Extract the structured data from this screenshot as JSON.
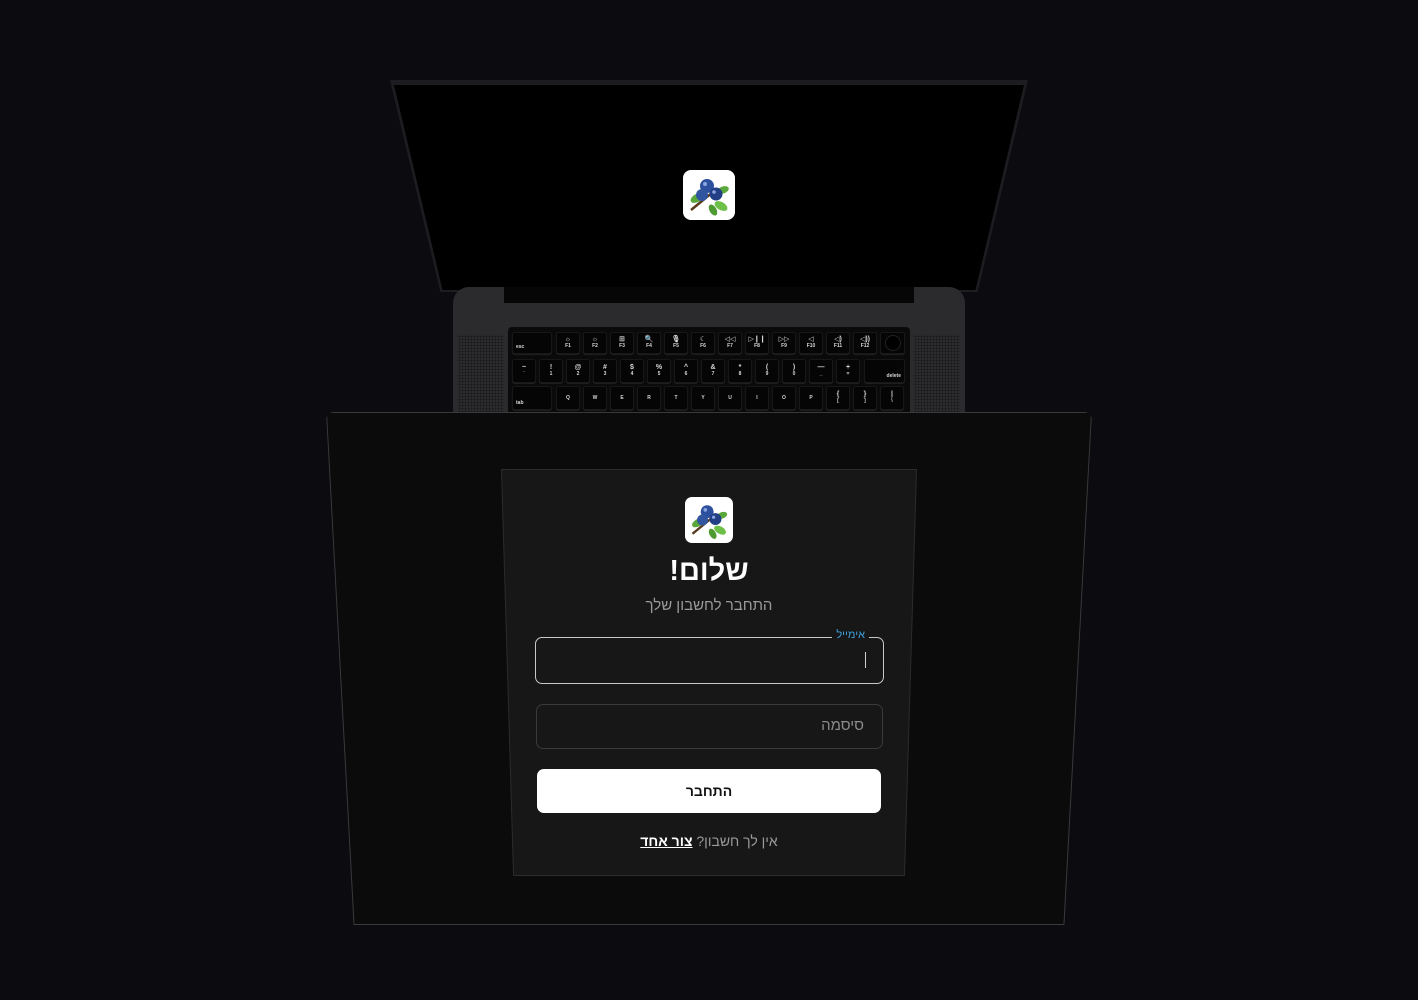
{
  "screen": {
    "logo_icon": "blueberry-logo-icon"
  },
  "keyboard": {
    "row_fn": [
      "esc",
      "F1",
      "F2",
      "F3",
      "F4",
      "F5",
      "F6",
      "F7",
      "F8",
      "F9",
      "F10",
      "F11",
      "F12"
    ],
    "row_fn_symbols": [
      "",
      "☼",
      "☼",
      "⊞",
      "🔍",
      "🎙",
      "☾",
      "◁◁",
      "▷❙❙",
      "▷▷",
      "◁",
      "◁)",
      "◁))"
    ],
    "row_num_top": [
      "~",
      "!",
      "@",
      "#",
      "$",
      "%",
      "^",
      "&",
      "*",
      "(",
      ")",
      "—",
      "+"
    ],
    "row_num_bottom": [
      "`",
      "1",
      "2",
      "3",
      "4",
      "5",
      "6",
      "7",
      "8",
      "9",
      "0",
      "_",
      "="
    ],
    "delete_label": "delete",
    "tab_label": "tab",
    "row_q": [
      "Q",
      "W",
      "E",
      "R",
      "T",
      "Y",
      "U",
      "I",
      "O",
      "P"
    ],
    "row_q_extra_top": [
      "{",
      "}",
      "|"
    ],
    "row_q_extra_bottom": [
      "[",
      "]",
      "\\"
    ]
  },
  "login": {
    "logo_icon": "blueberry-logo-icon",
    "title": "שלום!",
    "subtitle": "התחבר לחשבון שלך",
    "email_label": "אימייל",
    "email_value": "",
    "password_placeholder": "סיסמה",
    "submit_label": "התחבר",
    "signup_prompt": "אין לך חשבון?",
    "signup_link": "צור אחד"
  },
  "colors": {
    "background": "#0c0c10",
    "accent": "#3ea0de",
    "card": "#171717",
    "button": "#ffffff"
  }
}
